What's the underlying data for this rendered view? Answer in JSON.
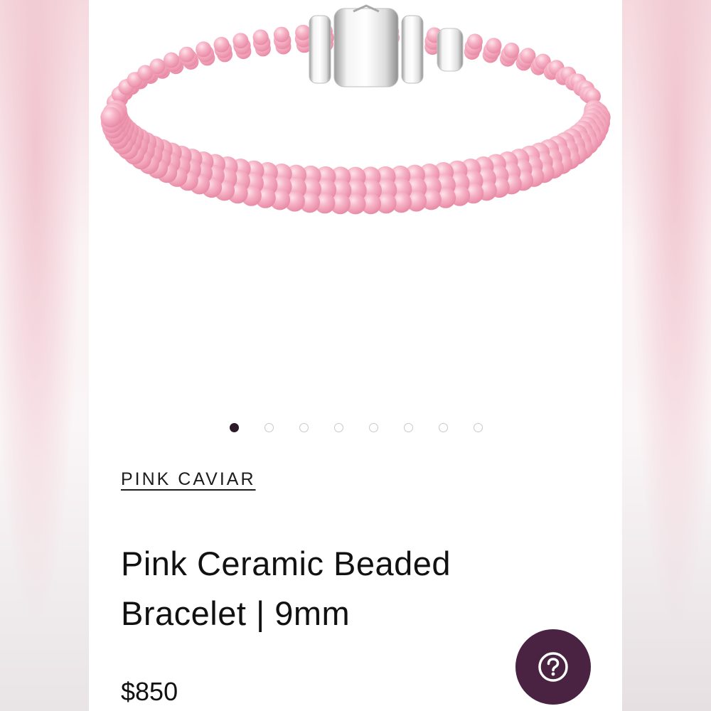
{
  "product": {
    "collection": "PINK CAVIAR",
    "title_line1": "Pink Ceramic Beaded",
    "title_line2": "Bracelet | 9mm",
    "price": "$850",
    "image_alt": "pink ceramic beaded bracelet with silver clasp"
  },
  "carousel": {
    "total_slides": 8,
    "active_index": 0
  },
  "help": {
    "icon": "question-mark-icon"
  },
  "colors": {
    "accent": "#4b2342",
    "active_dot": "#2b1a2a",
    "bead_pink": "#f5a7bd",
    "clasp_silver": "#dedede"
  }
}
